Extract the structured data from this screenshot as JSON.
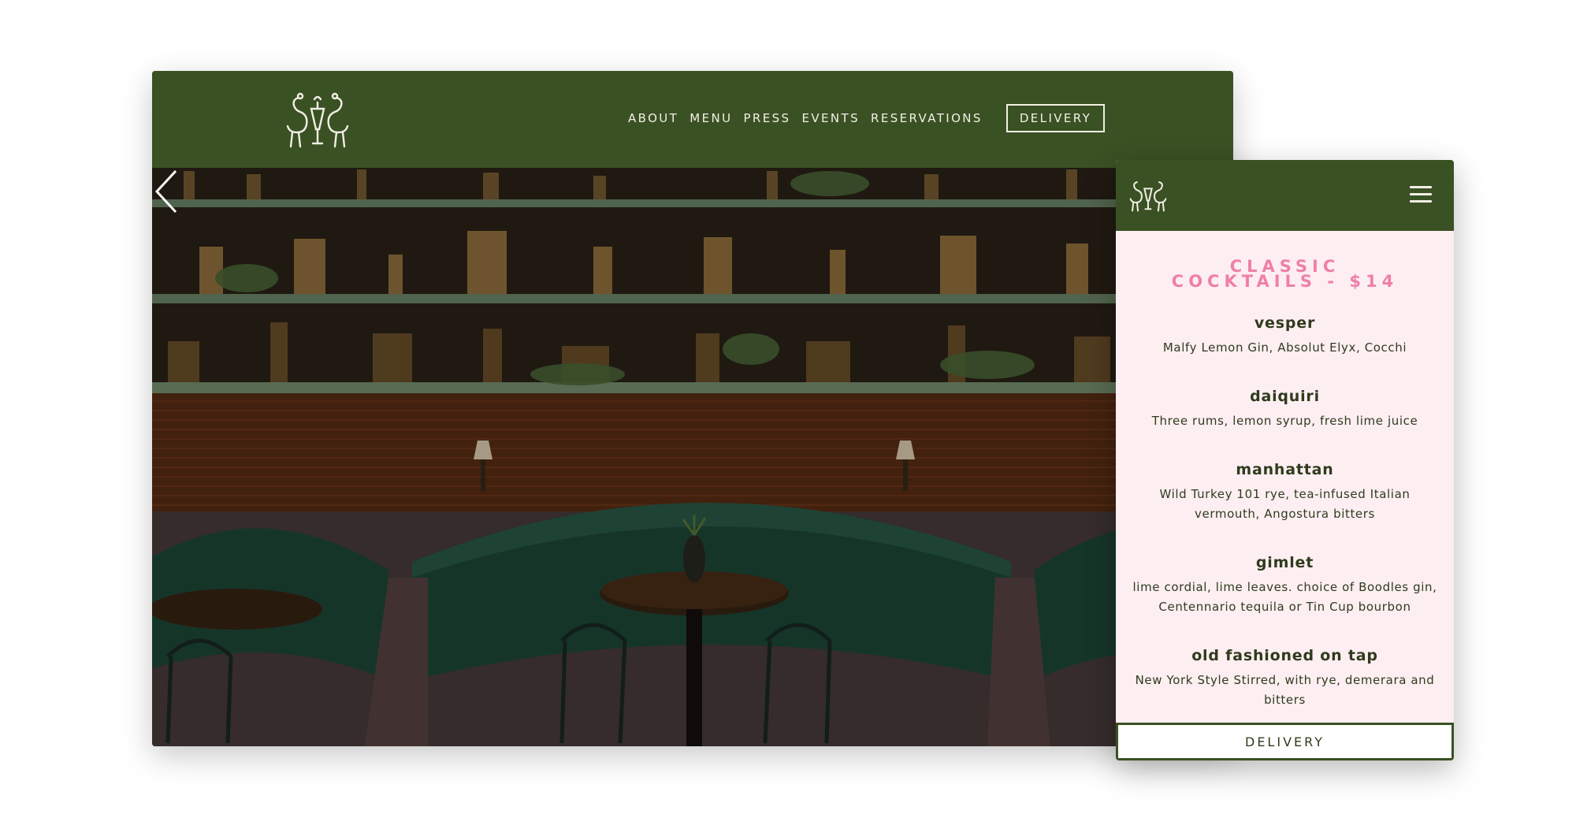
{
  "desktop": {
    "nav": [
      "ABOUT",
      "MENU",
      "PRESS",
      "EVENTS",
      "RESERVATIONS"
    ],
    "delivery_label": "DELIVERY"
  },
  "mobile": {
    "section_title": "CLASSIC COCKTAILS - $14",
    "cocktails": [
      {
        "name": "vesper",
        "desc": "Malfy Lemon Gin, Absolut Elyx, Cocchi"
      },
      {
        "name": "daiquiri",
        "desc": "Three rums, lemon syrup, fresh lime juice"
      },
      {
        "name": "manhattan",
        "desc": "Wild Turkey 101 rye, tea-infused Italian vermouth, Angostura bitters"
      },
      {
        "name": "gimlet",
        "desc": "lime cordial, lime leaves. choice of Boodles gin, Centennario tequila or Tin Cup bourbon"
      },
      {
        "name": "old fashioned on tap",
        "desc": "New York Style Stirred, with rye, demerara and bitters"
      }
    ],
    "delivery_label": "DELIVERY"
  },
  "colors": {
    "brand_green": "#3a5124",
    "accent_pink": "#ef7fa8",
    "menu_bg": "#fdeef2",
    "text_dark": "#2f3b1c",
    "cream": "#f2efe4"
  },
  "icons": [
    "flamingo-logo-icon",
    "chevron-left-icon",
    "hamburger-menu-icon"
  ]
}
